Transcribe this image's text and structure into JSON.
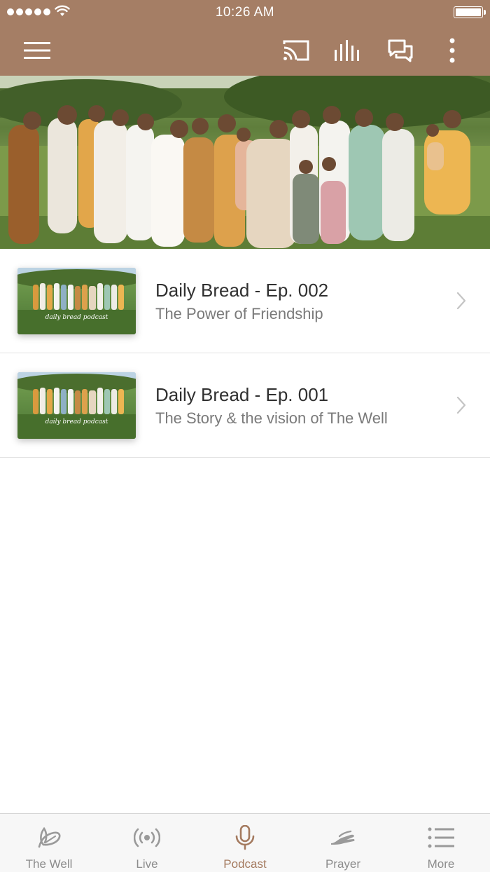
{
  "status_bar": {
    "time": "10:26 AM",
    "signal_dots": 5,
    "battery_level": 1.0
  },
  "nav_bar": {
    "icons": [
      "menu-icon",
      "cast-icon",
      "audio-levels-icon",
      "chat-icon",
      "more-vertical-icon"
    ]
  },
  "hero": {
    "image": "group-photo-women-in-field"
  },
  "episodes": [
    {
      "title": "Daily Bread - Ep. 002",
      "subtitle": "The Power of Friendship",
      "thumbnail_text": "daily bread podcast"
    },
    {
      "title": "Daily Bread - Ep. 001",
      "subtitle": "The Story & the vision of The Well",
      "thumbnail_text": "daily bread podcast"
    }
  ],
  "tab_bar": {
    "tabs": [
      {
        "label": "The Well",
        "icon": "leaf-icon",
        "active": false
      },
      {
        "label": "Live",
        "icon": "broadcast-icon",
        "active": false
      },
      {
        "label": "Podcast",
        "icon": "microphone-icon",
        "active": true
      },
      {
        "label": "Prayer",
        "icon": "praying-hands-icon",
        "active": false
      },
      {
        "label": "More",
        "icon": "list-icon",
        "active": false
      }
    ]
  },
  "colors": {
    "header": "#a57e65",
    "accent": "#a47a5f",
    "inactive": "#8c8c8c"
  }
}
